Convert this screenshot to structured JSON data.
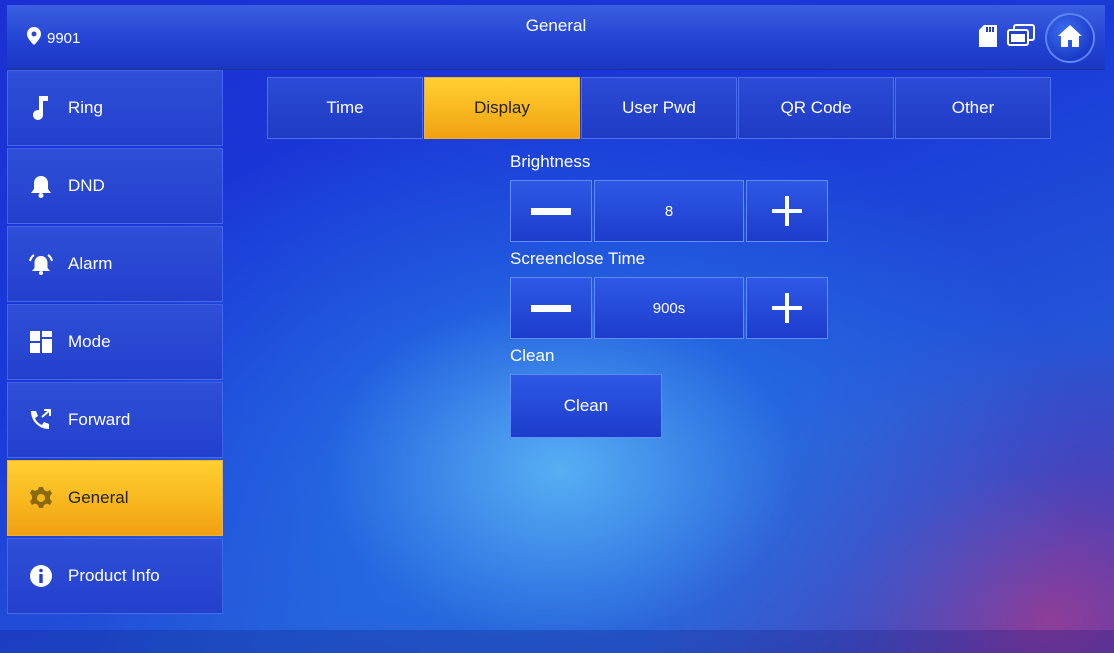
{
  "header": {
    "location": "9901",
    "title": "General",
    "icons": [
      "sd-card-icon",
      "screens-icon",
      "home-icon"
    ]
  },
  "sidebar": {
    "items": [
      {
        "label": "Ring",
        "icon": "music-note-icon"
      },
      {
        "label": "DND",
        "icon": "bell-icon"
      },
      {
        "label": "Alarm",
        "icon": "alarm-icon"
      },
      {
        "label": "Mode",
        "icon": "grid-icon"
      },
      {
        "label": "Forward",
        "icon": "forward-call-icon"
      },
      {
        "label": "General",
        "icon": "gear-icon",
        "active": true
      },
      {
        "label": "Product Info",
        "icon": "info-icon"
      }
    ]
  },
  "tabs": [
    {
      "label": "Time"
    },
    {
      "label": "Display",
      "active": true
    },
    {
      "label": "User Pwd"
    },
    {
      "label": "QR Code"
    },
    {
      "label": "Other"
    }
  ],
  "display": {
    "brightness_label": "Brightness",
    "brightness_value": "8",
    "screenclose_label": "Screenclose Time",
    "screenclose_value": "900s",
    "clean_label": "Clean",
    "clean_button": "Clean"
  },
  "colors": {
    "accent": "#f7b51c",
    "primary": "#2340cc"
  }
}
